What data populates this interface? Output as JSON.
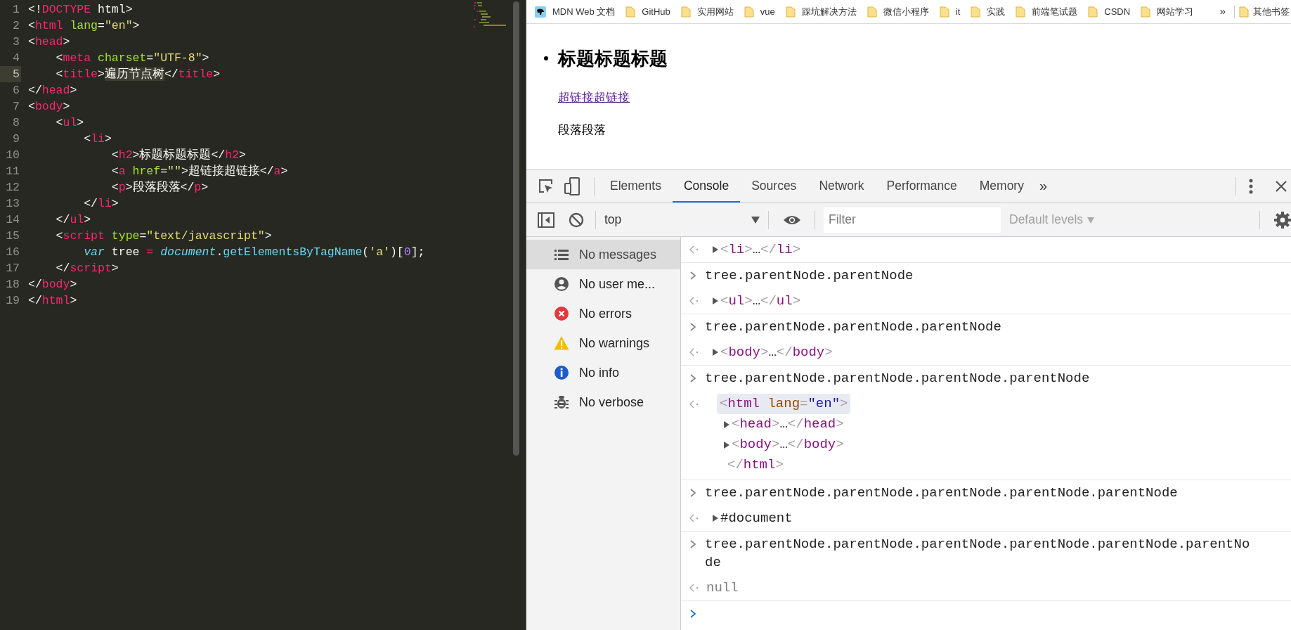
{
  "editor": {
    "lines": [
      {
        "number": "1",
        "current": false,
        "tokens": [
          {
            "text": "<!",
            "kind": "punct"
          },
          {
            "text": "DOCTYPE",
            "kind": "tag"
          },
          {
            "text": " html>",
            "kind": "punct"
          }
        ]
      },
      {
        "number": "2",
        "current": false,
        "tokens": [
          {
            "text": "<",
            "kind": "punct"
          },
          {
            "text": "html",
            "kind": "tag"
          },
          {
            "text": " lang",
            "kind": "attr"
          },
          {
            "text": "=",
            "kind": "punct"
          },
          {
            "text": "\"en\"",
            "kind": "string"
          },
          {
            "text": ">",
            "kind": "punct"
          }
        ]
      },
      {
        "number": "3",
        "current": false,
        "tokens": [
          {
            "text": "<",
            "kind": "punct"
          },
          {
            "text": "head",
            "kind": "tag"
          },
          {
            "text": ">",
            "kind": "punct"
          }
        ]
      },
      {
        "number": "4",
        "current": false,
        "tokens": [
          {
            "text": "    <",
            "kind": "punct"
          },
          {
            "text": "meta",
            "kind": "tag"
          },
          {
            "text": " charset",
            "kind": "attr"
          },
          {
            "text": "=",
            "kind": "punct"
          },
          {
            "text": "\"UTF-8\"",
            "kind": "string"
          },
          {
            "text": ">",
            "kind": "punct"
          }
        ]
      },
      {
        "number": "5",
        "current": true,
        "tokens": [
          {
            "text": "    <",
            "kind": "punct"
          },
          {
            "text": "title",
            "kind": "tag"
          },
          {
            "text": ">",
            "kind": "punct"
          },
          {
            "text": "遍历节点树",
            "kind": "marked"
          },
          {
            "text": "</",
            "kind": "punct"
          },
          {
            "text": "title",
            "kind": "tag"
          },
          {
            "text": ">",
            "kind": "punct"
          }
        ]
      },
      {
        "number": "6",
        "current": false,
        "tokens": [
          {
            "text": "</",
            "kind": "punct"
          },
          {
            "text": "head",
            "kind": "tag"
          },
          {
            "text": ">",
            "kind": "punct"
          }
        ]
      },
      {
        "number": "7",
        "current": false,
        "tokens": [
          {
            "text": "<",
            "kind": "punct"
          },
          {
            "text": "body",
            "kind": "tag"
          },
          {
            "text": ">",
            "kind": "punct"
          }
        ]
      },
      {
        "number": "8",
        "current": false,
        "tokens": [
          {
            "text": "    <",
            "kind": "punct"
          },
          {
            "text": "ul",
            "kind": "tag"
          },
          {
            "text": ">",
            "kind": "punct"
          }
        ]
      },
      {
        "number": "9",
        "current": false,
        "tokens": [
          {
            "text": "        <",
            "kind": "punct"
          },
          {
            "text": "li",
            "kind": "tag"
          },
          {
            "text": ">",
            "kind": "punct"
          }
        ]
      },
      {
        "number": "10",
        "current": false,
        "tokens": [
          {
            "text": "            <",
            "kind": "punct"
          },
          {
            "text": "h2",
            "kind": "tag"
          },
          {
            "text": ">标题标题标题</",
            "kind": "punct"
          },
          {
            "text": "h2",
            "kind": "tag"
          },
          {
            "text": ">",
            "kind": "punct"
          }
        ]
      },
      {
        "number": "11",
        "current": false,
        "tokens": [
          {
            "text": "            <",
            "kind": "punct"
          },
          {
            "text": "a",
            "kind": "tag"
          },
          {
            "text": " href",
            "kind": "attr"
          },
          {
            "text": "=",
            "kind": "punct"
          },
          {
            "text": "\"\"",
            "kind": "string"
          },
          {
            "text": ">超链接超链接</",
            "kind": "punct"
          },
          {
            "text": "a",
            "kind": "tag"
          },
          {
            "text": ">",
            "kind": "punct"
          }
        ]
      },
      {
        "number": "12",
        "current": false,
        "tokens": [
          {
            "text": "            <",
            "kind": "punct"
          },
          {
            "text": "p",
            "kind": "tag"
          },
          {
            "text": ">段落段落</",
            "kind": "punct"
          },
          {
            "text": "p",
            "kind": "tag"
          },
          {
            "text": ">",
            "kind": "punct"
          }
        ]
      },
      {
        "number": "13",
        "current": false,
        "tokens": [
          {
            "text": "        </",
            "kind": "punct"
          },
          {
            "text": "li",
            "kind": "tag"
          },
          {
            "text": ">",
            "kind": "punct"
          }
        ]
      },
      {
        "number": "14",
        "current": false,
        "tokens": [
          {
            "text": "    </",
            "kind": "punct"
          },
          {
            "text": "ul",
            "kind": "tag"
          },
          {
            "text": ">",
            "kind": "punct"
          }
        ]
      },
      {
        "number": "15",
        "current": false,
        "tokens": [
          {
            "text": "    <",
            "kind": "punct"
          },
          {
            "text": "script",
            "kind": "tag"
          },
          {
            "text": " type",
            "kind": "attr"
          },
          {
            "text": "=",
            "kind": "punct"
          },
          {
            "text": "\"text/javascript\"",
            "kind": "string"
          },
          {
            "text": ">",
            "kind": "punct"
          }
        ]
      },
      {
        "number": "16",
        "current": false,
        "tokens": [
          {
            "text": "        var",
            "kind": "keyword"
          },
          {
            "text": " tree ",
            "kind": "punct"
          },
          {
            "text": "=",
            "kind": "operator"
          },
          {
            "text": " document",
            "kind": "builtin"
          },
          {
            "text": ".",
            "kind": "punct"
          },
          {
            "text": "getElementsByTagName",
            "kind": "function"
          },
          {
            "text": "(",
            "kind": "punct"
          },
          {
            "text": "'a'",
            "kind": "string"
          },
          {
            "text": ")[",
            "kind": "punct"
          },
          {
            "text": "0",
            "kind": "number"
          },
          {
            "text": "];",
            "kind": "punct"
          }
        ]
      },
      {
        "number": "17",
        "current": false,
        "tokens": [
          {
            "text": "    </",
            "kind": "punct"
          },
          {
            "text": "script",
            "kind": "tag"
          },
          {
            "text": ">",
            "kind": "punct"
          }
        ]
      },
      {
        "number": "18",
        "current": false,
        "tokens": [
          {
            "text": "</",
            "kind": "punct"
          },
          {
            "text": "body",
            "kind": "tag"
          },
          {
            "text": ">",
            "kind": "punct"
          }
        ]
      },
      {
        "number": "19",
        "current": false,
        "tokens": [
          {
            "text": "</",
            "kind": "punct"
          },
          {
            "text": "html",
            "kind": "tag"
          },
          {
            "text": ">",
            "kind": "punct"
          }
        ]
      }
    ]
  },
  "bookmarks": {
    "items": [
      {
        "label": "MDN Web 文档",
        "kind": "site"
      },
      {
        "label": "GitHub",
        "kind": "folder"
      },
      {
        "label": "实用网站",
        "kind": "folder"
      },
      {
        "label": "vue",
        "kind": "folder"
      },
      {
        "label": "踩坑解决方法",
        "kind": "folder"
      },
      {
        "label": "微信小程序",
        "kind": "folder"
      },
      {
        "label": "it",
        "kind": "folder"
      },
      {
        "label": "实践",
        "kind": "folder"
      },
      {
        "label": "前端笔试题",
        "kind": "folder"
      },
      {
        "label": "CSDN",
        "kind": "folder"
      },
      {
        "label": "网站学习",
        "kind": "folder"
      }
    ],
    "more": "»",
    "other": {
      "label": "其他书签",
      "kind": "folder"
    }
  },
  "page": {
    "heading": "标题标题标题",
    "link": "超链接超链接",
    "paragraph": "段落段落"
  },
  "devtools": {
    "tabs": [
      {
        "label": "Elements",
        "selected": false
      },
      {
        "label": "Console",
        "selected": true
      },
      {
        "label": "Sources",
        "selected": false
      },
      {
        "label": "Network",
        "selected": false
      },
      {
        "label": "Performance",
        "selected": false
      },
      {
        "label": "Memory",
        "selected": false
      }
    ],
    "more_tabs": "»",
    "context": "top",
    "filter_placeholder": "Filter",
    "levels": "Default levels"
  },
  "console": {
    "sidebar": [
      {
        "label": "No messages",
        "kind": "list",
        "selected": true
      },
      {
        "label": "No user me...",
        "kind": "user",
        "selected": false
      },
      {
        "label": "No errors",
        "kind": "error",
        "selected": false
      },
      {
        "label": "No warnings",
        "kind": "warning",
        "selected": false
      },
      {
        "label": "No info",
        "kind": "info",
        "selected": false
      },
      {
        "label": "No verbose",
        "kind": "verbose",
        "selected": false
      }
    ],
    "groups": [
      {
        "output": {
          "kind": "node",
          "text": "<li>…</li>",
          "expanded": false
        }
      },
      {
        "input": "tree.parentNode.parentNode",
        "output": {
          "kind": "node",
          "text": "<ul>…</ul>",
          "expanded": false
        }
      },
      {
        "input": "tree.parentNode.parentNode.parentNode",
        "output": {
          "kind": "node",
          "text": "<body>…</body>",
          "expanded": false
        }
      },
      {
        "input": "tree.parentNode.parentNode.parentNode.parentNode",
        "output": {
          "kind": "tree",
          "text": "<html lang=\"en\">",
          "children": [
            {
              "text": "<head>…</head>",
              "expanded": false
            },
            {
              "text": "<body>…</body>",
              "expanded": false
            }
          ],
          "closing": "</html>"
        }
      },
      {
        "input": "tree.parentNode.parentNode.parentNode.parentNode.parentNode",
        "output": {
          "kind": "object",
          "text": "#document",
          "expanded": false
        }
      },
      {
        "input": "tree.parentNode.parentNode.parentNode.parentNode.parentNode.parentNode",
        "output": {
          "kind": "null",
          "text": "null"
        }
      }
    ]
  }
}
